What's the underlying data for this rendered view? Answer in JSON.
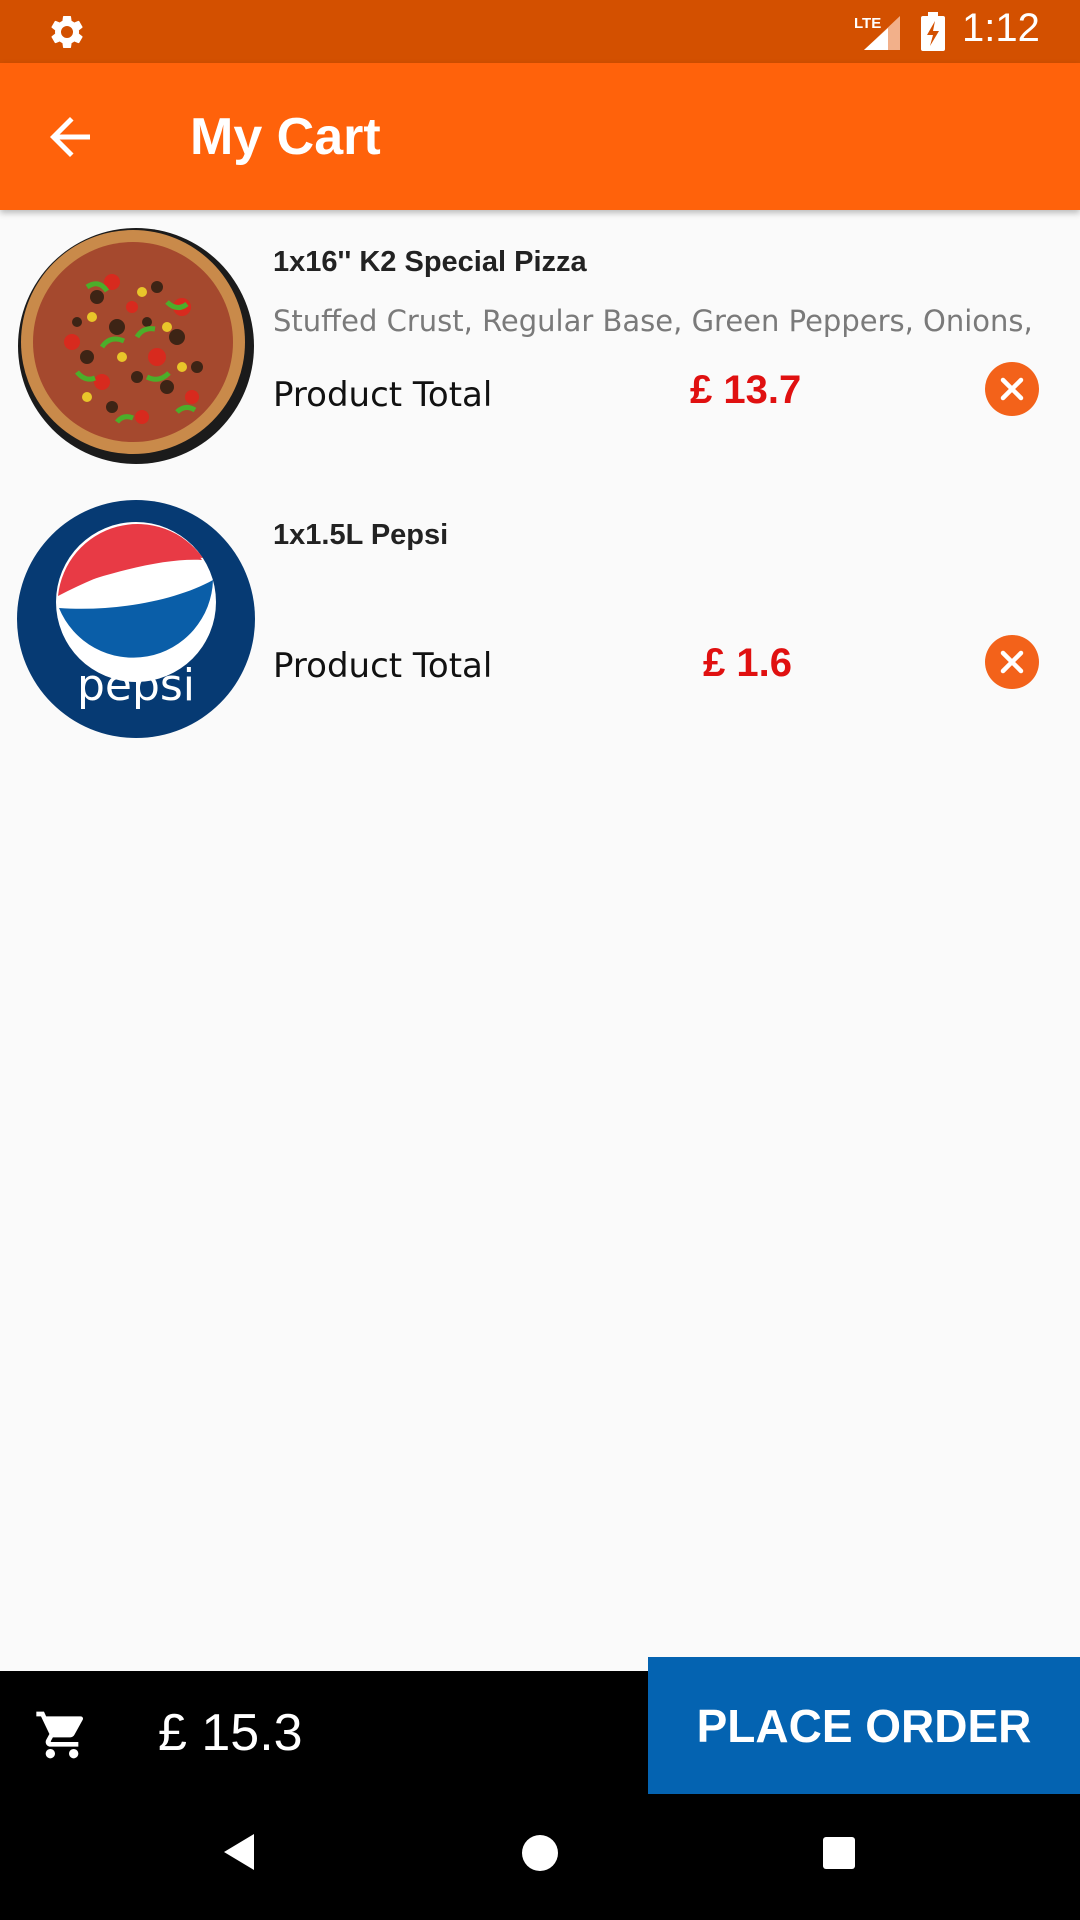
{
  "status_bar": {
    "time": "1:12",
    "network": "LTE"
  },
  "app_bar": {
    "title": "My Cart"
  },
  "cart_items": [
    {
      "name": "1x16'' K2 Special Pizza",
      "description": "Stuffed Crust, Regular Base, Green Peppers, Onions,",
      "total_label": "Product Total",
      "total_value": "£ 13.7",
      "image": "pizza-image"
    },
    {
      "name": "1x1.5L Pepsi",
      "description": "",
      "total_label": "Product Total",
      "total_value": "£ 1.6",
      "image": "pepsi-logo-image",
      "logo_text": "pepsi"
    }
  ],
  "bottom_bar": {
    "cart_total": "£ 15.3",
    "place_order_label": "PLACE ORDER"
  },
  "colors": {
    "status_bar": "#d35000",
    "app_bar": "#ff620b",
    "price": "#e01010",
    "remove": "#f3621a",
    "place_order": "#0463b1"
  }
}
